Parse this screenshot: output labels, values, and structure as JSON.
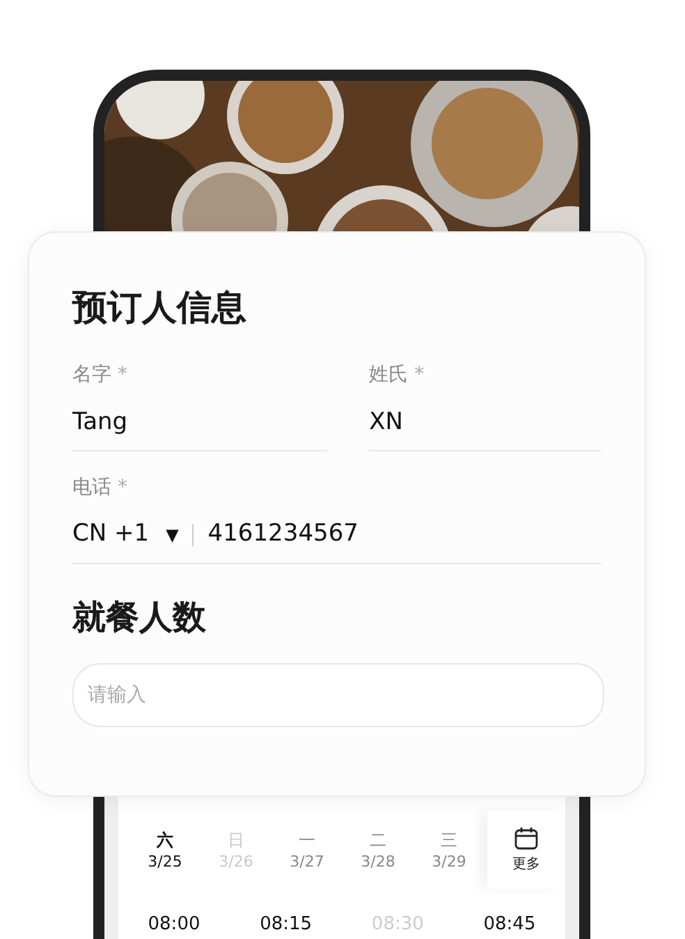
{
  "booker": {
    "title": "预订人信息",
    "first_name": {
      "label": "名字",
      "required_mark": "*",
      "value": "Tang"
    },
    "last_name": {
      "label": "姓氏",
      "required_mark": "*",
      "value": "XN"
    },
    "phone": {
      "label": "电话",
      "required_mark": "*",
      "country": "CN +1",
      "caret": "▼",
      "value": "4161234567"
    }
  },
  "party_size": {
    "title": "就餐人数",
    "placeholder": "请输入"
  },
  "dates": [
    {
      "weekday": "六",
      "date": "3/25",
      "selected": true,
      "disabled": false
    },
    {
      "weekday": "日",
      "date": "3/26",
      "selected": false,
      "disabled": true
    },
    {
      "weekday": "一",
      "date": "3/27",
      "selected": false,
      "disabled": false
    },
    {
      "weekday": "二",
      "date": "3/28",
      "selected": false,
      "disabled": false
    },
    {
      "weekday": "三",
      "date": "3/29",
      "selected": false,
      "disabled": false
    }
  ],
  "more_dates": {
    "label": "更多"
  },
  "times": [
    {
      "time": "08:00",
      "disabled": false
    },
    {
      "time": "08:15",
      "disabled": false
    },
    {
      "time": "08:30",
      "disabled": true
    },
    {
      "time": "08:45",
      "disabled": false
    }
  ]
}
